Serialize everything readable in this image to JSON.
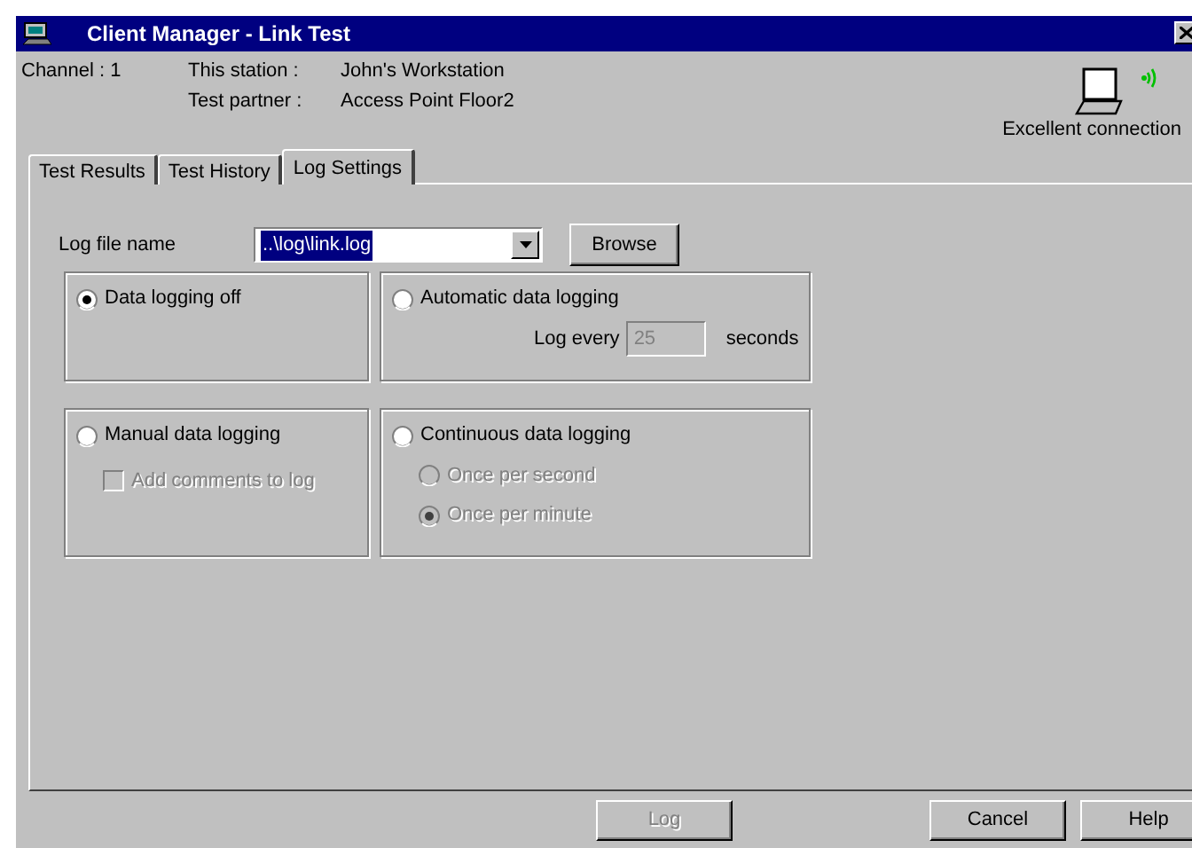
{
  "window": {
    "title": "Client Manager - Link Test"
  },
  "header": {
    "channel": "Channel : 1",
    "station_label": "This station :",
    "station": "John's Workstation",
    "partner_label": "Test partner :",
    "partner": "Access Point Floor2",
    "connection": "Excellent connection"
  },
  "tabs": [
    {
      "label": "Test Results",
      "selected": false
    },
    {
      "label": "Test History",
      "selected": false
    },
    {
      "label": "Log Settings",
      "selected": true
    }
  ],
  "log_file": {
    "label": "Log file name",
    "value": "..\\log\\link.log",
    "browse": "Browse"
  },
  "groups": [
    {
      "label": "Data logging off",
      "selected": true
    },
    {
      "label": "Automatic data logging",
      "selected": false,
      "interval": {
        "label": "Log every",
        "value": "25",
        "unit": "seconds",
        "disabled": true
      }
    },
    {
      "label": "Manual data logging",
      "selected": false,
      "option": {
        "label": "Add comments to log",
        "checked": false,
        "disabled": true
      }
    },
    {
      "label": "Continuous data logging",
      "selected": false,
      "rates": [
        {
          "label": "Once per second",
          "selected": false,
          "disabled": true
        },
        {
          "label": "Once per minute",
          "selected": true,
          "disabled": true
        }
      ]
    }
  ],
  "buttons": [
    {
      "label": "Log",
      "disabled": true
    },
    {
      "label": "Cancel",
      "disabled": false
    },
    {
      "label": "Help",
      "disabled": false
    }
  ]
}
